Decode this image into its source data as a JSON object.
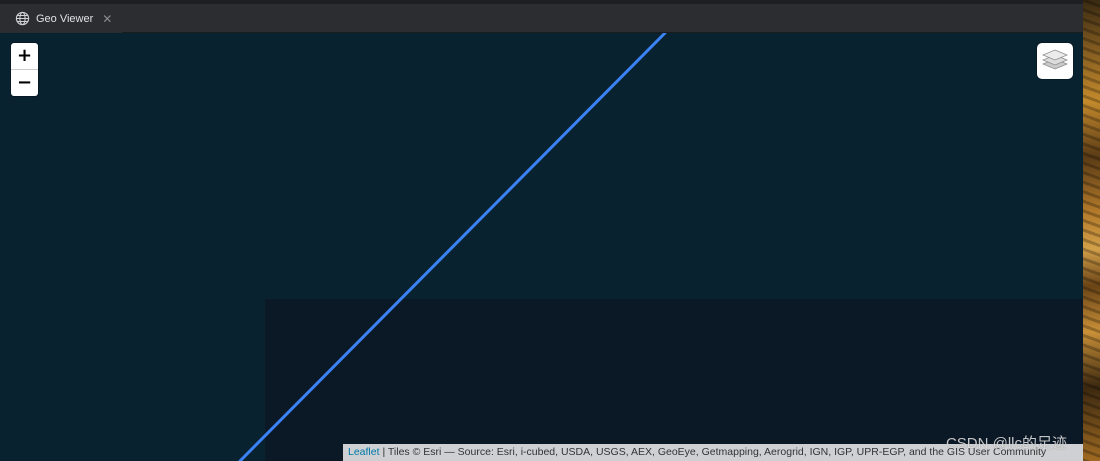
{
  "tab": {
    "title": "Geo Viewer",
    "icon": "globe-icon",
    "close_glyph": "✕"
  },
  "map": {
    "zoom_in_label": "+",
    "zoom_out_label": "−",
    "layers_icon": "layers-icon",
    "route_color": "#3b82f6",
    "attribution": {
      "link_text": "Leaflet",
      "text": " | Tiles © Esri — Source: Esri, i-cubed, USDA, USGS, AEX, GeoEye, Getmapping, Aerogrid, IGN, IGP, UPR-EGP, and the GIS User Community"
    }
  },
  "watermark": "CSDN @llc的足迹",
  "colors": {
    "map_bg": "#082230",
    "map_block": "#0b1826",
    "tabbar": "#2b2d30"
  }
}
